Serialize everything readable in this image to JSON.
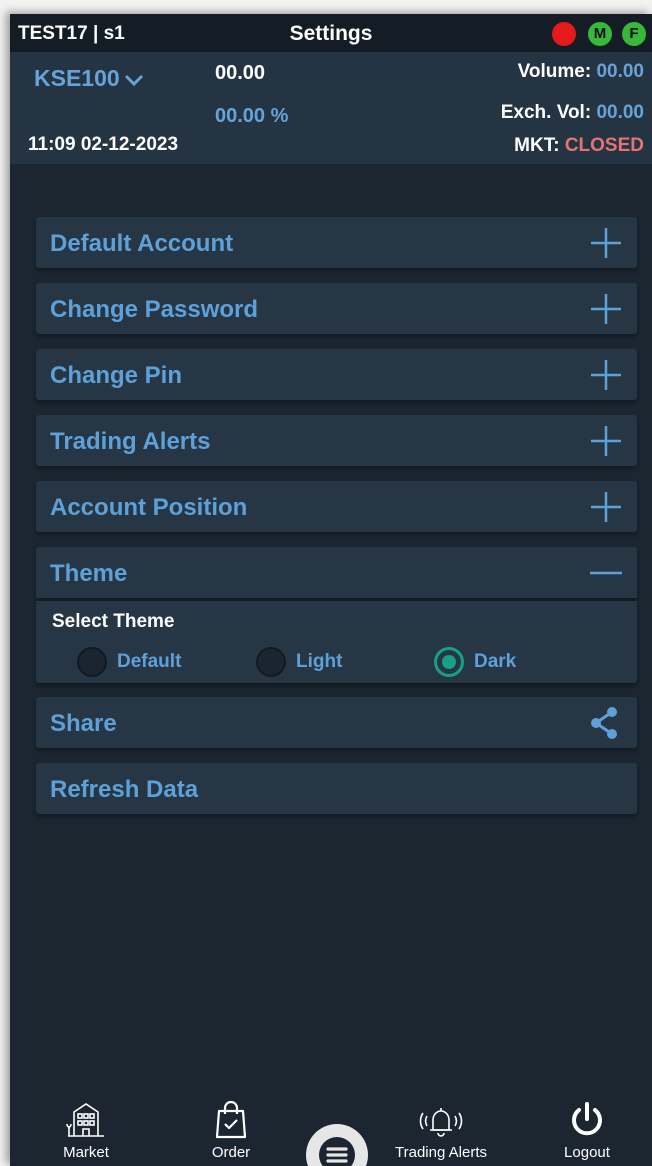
{
  "header": {
    "user": "TEST17 | s1",
    "title": "Settings",
    "indicators": {
      "m": "M",
      "f": "F"
    }
  },
  "market": {
    "index": "KSE100",
    "price": "00.00",
    "change_pct": "00.00 %",
    "datetime": "11:09 02-12-2023",
    "volume_label": "Volume: ",
    "volume_value": "00.00",
    "exch_vol_label": "Exch. Vol: ",
    "exch_vol_value": "00.00",
    "mkt_label": "MKT: ",
    "mkt_status": "CLOSED"
  },
  "settings": [
    {
      "label": "Default Account",
      "icon": "plus-icon"
    },
    {
      "label": "Change Password",
      "icon": "plus-icon"
    },
    {
      "label": "Change Pin",
      "icon": "plus-icon"
    },
    {
      "label": "Trading Alerts",
      "icon": "plus-icon"
    },
    {
      "label": "Account Position",
      "icon": "plus-icon"
    },
    {
      "label": "Theme",
      "icon": "minus-icon"
    },
    {
      "label": "Share",
      "icon": "share-icon"
    },
    {
      "label": "Refresh Data",
      "icon": ""
    }
  ],
  "theme": {
    "select_label": "Select Theme",
    "options": [
      "Default",
      "Light",
      "Dark"
    ],
    "selected": "Dark"
  },
  "nav": {
    "market": "Market",
    "order": "Order",
    "alerts": "Trading Alerts",
    "logout": "Logout"
  },
  "colors": {
    "accent": "#5ea0d8",
    "closed": "#e47474",
    "radio_selected": "#16a085"
  }
}
